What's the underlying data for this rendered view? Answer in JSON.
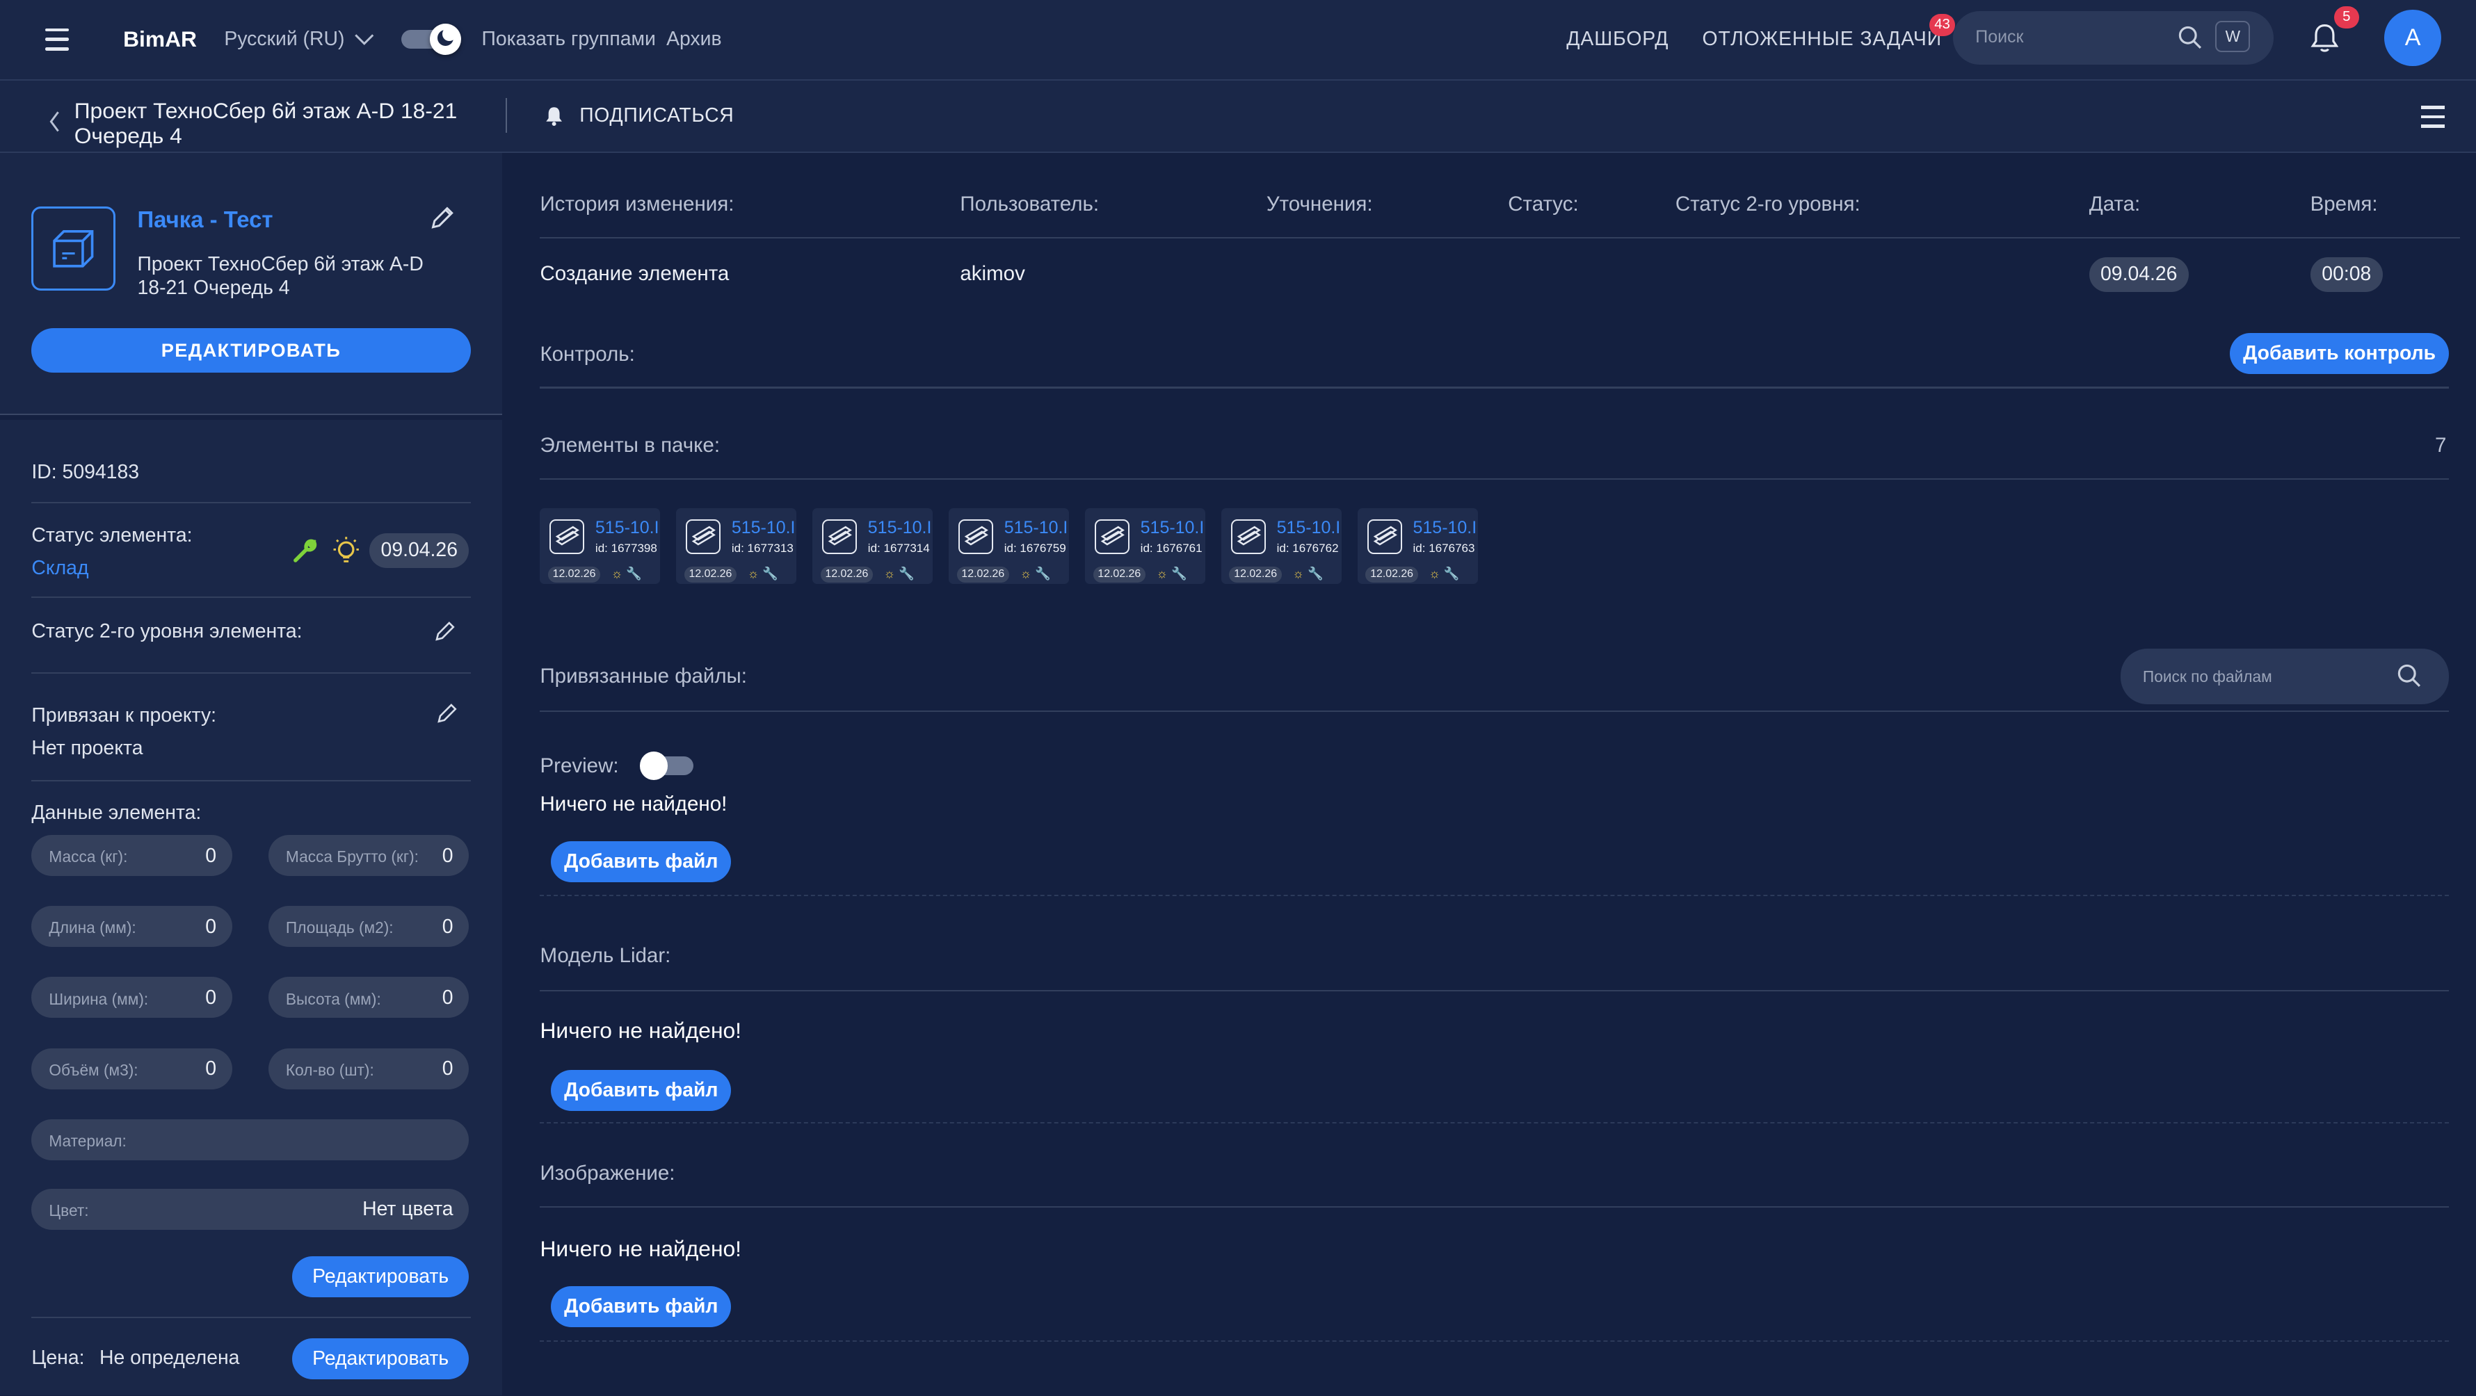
{
  "header": {
    "logo": "BimAR",
    "language": "Русский (RU)",
    "show_groups": "Показать группами",
    "archive": "Архив",
    "dashboard": "ДАШБОРД",
    "deferred_tasks": "ОТЛОЖЕННЫЕ ЗАДАЧИ",
    "deferred_badge": "43",
    "search_placeholder": "Поиск",
    "search_key": "W",
    "notifications_badge": "5",
    "avatar_letter": "A"
  },
  "subheader": {
    "project_title_line1": "Проект ТехноСбер 6й этаж A-D 18-21",
    "project_title_line2": "Очередь 4",
    "subscribe": "ПОДПИСАТЬСЯ"
  },
  "item": {
    "name": "Пачка - Тест",
    "project_line1": "Проект ТехноСбер 6й этаж A-D",
    "project_line2": "18-21 Очередь 4",
    "edit_button": "РЕДАКТИРОВАТЬ",
    "id_text": "ID: 5094183",
    "status_label": "Статус элемента:",
    "status_value": "Склад",
    "status_date": "09.04.26",
    "status2_label": "Статус 2-го уровня элемента:",
    "linked_label": "Привязан к проекту:",
    "linked_value": "Нет проекта",
    "data_label": "Данные элемента:",
    "fields": [
      {
        "label": "Масса (кг):",
        "value": "0"
      },
      {
        "label": "Масса Брутто (кг):",
        "value": "0"
      },
      {
        "label": "Длина (мм):",
        "value": "0"
      },
      {
        "label": "Площадь (м2):",
        "value": "0"
      },
      {
        "label": "Ширина (мм):",
        "value": "0"
      },
      {
        "label": "Высота (мм):",
        "value": "0"
      },
      {
        "label": "Объём (м3):",
        "value": "0"
      },
      {
        "label": "Кол-во (шт):",
        "value": "0"
      }
    ],
    "material_label": "Материал:",
    "color_label": "Цвет:",
    "color_value": "Нет цвета",
    "edit_small": "Редактировать",
    "price_label": "Цена:",
    "price_value": "Не определена",
    "price_edit": "Редактировать"
  },
  "history": {
    "columns": [
      "История изменения:",
      "Пользователь:",
      "Уточнения:",
      "Статус:",
      "Статус 2-го уровня:",
      "Дата:",
      "Время:"
    ],
    "row": {
      "change": "Создание элемента",
      "user": "akimov",
      "date": "09.04.26",
      "time": "00:08"
    }
  },
  "control": {
    "label": "Контроль:",
    "add_button": "Добавить контроль"
  },
  "elements": {
    "label": "Элементы в пачке:",
    "count": "7",
    "cards": [
      {
        "name": "515-10.I",
        "id": "id: 1677398",
        "date": "12.02.26"
      },
      {
        "name": "515-10.I",
        "id": "id: 1677313",
        "date": "12.02.26"
      },
      {
        "name": "515-10.I",
        "id": "id: 1677314",
        "date": "12.02.26"
      },
      {
        "name": "515-10.I",
        "id": "id: 1676759",
        "date": "12.02.26"
      },
      {
        "name": "515-10.I",
        "id": "id: 1676761",
        "date": "12.02.26"
      },
      {
        "name": "515-10.I",
        "id": "id: 1676762",
        "date": "12.02.26"
      },
      {
        "name": "515-10.I",
        "id": "id: 1676763",
        "date": "12.02.26"
      }
    ]
  },
  "files": {
    "label": "Привязанные файлы:",
    "search_placeholder": "Поиск по файлам",
    "preview_label": "Preview:",
    "not_found": "Ничего не найдено!",
    "add_file": "Добавить файл"
  },
  "lidar": {
    "label": "Модель Lidar:",
    "not_found": "Ничего не найдено!",
    "add_file": "Добавить файл"
  },
  "image": {
    "label": "Изображение:",
    "not_found": "Ничего не найдено!",
    "add_file": "Добавить файл"
  },
  "colors": {
    "accent": "#2c7af0",
    "link": "#3b8af8",
    "badge": "#e53950",
    "bg": "#142040",
    "panel": "#1a2748"
  }
}
